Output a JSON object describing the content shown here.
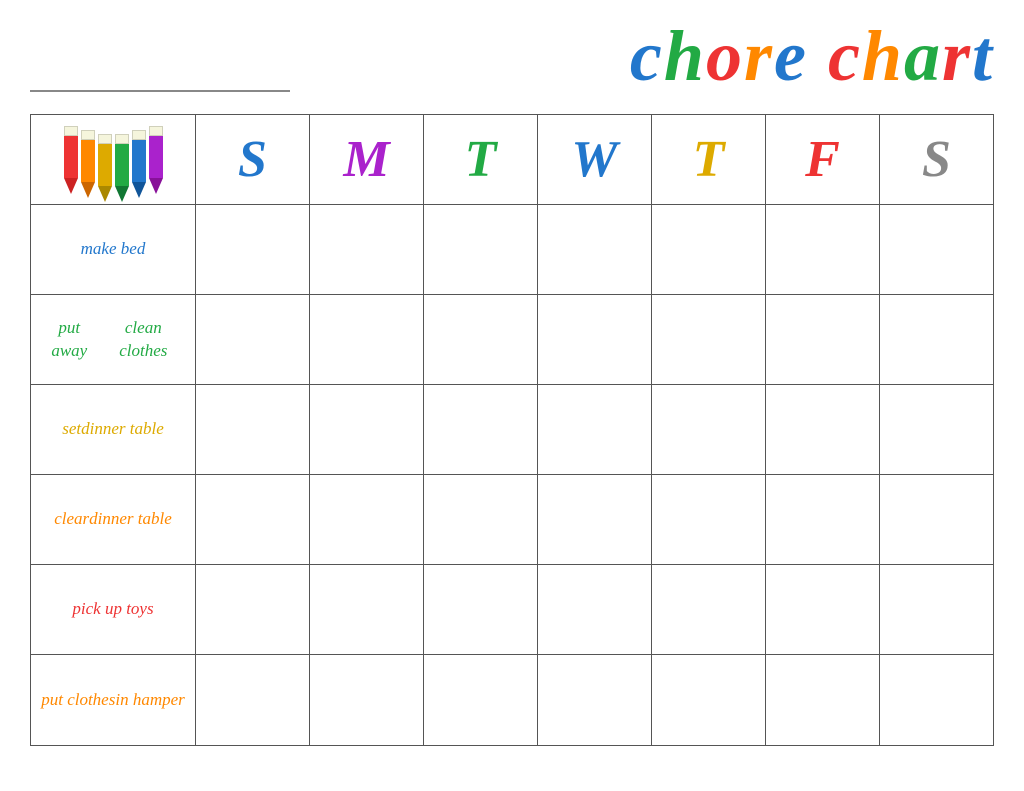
{
  "header": {
    "title": "chore chart",
    "name_line_placeholder": ""
  },
  "days": [
    {
      "label": "S",
      "color": "#2277CC"
    },
    {
      "label": "M",
      "color": "#AA22CC"
    },
    {
      "label": "T",
      "color": "#22AA44"
    },
    {
      "label": "W",
      "color": "#2277CC"
    },
    {
      "label": "T",
      "color": "#DDAA00"
    },
    {
      "label": "F",
      "color": "#EE3333"
    },
    {
      "label": "S",
      "color": "#888888"
    }
  ],
  "chores": [
    {
      "label": "make bed",
      "color": "#2277CC",
      "lines": [
        "make bed"
      ]
    },
    {
      "label": "put away clean clothes",
      "color": "#22AA44",
      "lines": [
        "put away",
        "clean clothes"
      ]
    },
    {
      "label": "set dinner table",
      "color": "#DDAA00",
      "lines": [
        "set",
        "dinner table"
      ]
    },
    {
      "label": "clear dinner table",
      "color": "#FF8800",
      "lines": [
        "clear",
        "dinner table"
      ]
    },
    {
      "label": "pick up toys",
      "color": "#EE3333",
      "lines": [
        "pick up toys"
      ]
    },
    {
      "label": "put clothes in hamper",
      "color": "#FF8800",
      "lines": [
        "put clothes",
        "in hamper"
      ]
    }
  ],
  "crayons": [
    {
      "color": "#EE3333",
      "tip_color": "#CC2222"
    },
    {
      "color": "#FF8800",
      "tip_color": "#CC6600"
    },
    {
      "color": "#DDAA00",
      "tip_color": "#AA8800"
    },
    {
      "color": "#22AA44",
      "tip_color": "#117733"
    },
    {
      "color": "#2277CC",
      "tip_color": "#115599"
    },
    {
      "color": "#AA22CC",
      "tip_color": "#881199"
    }
  ]
}
